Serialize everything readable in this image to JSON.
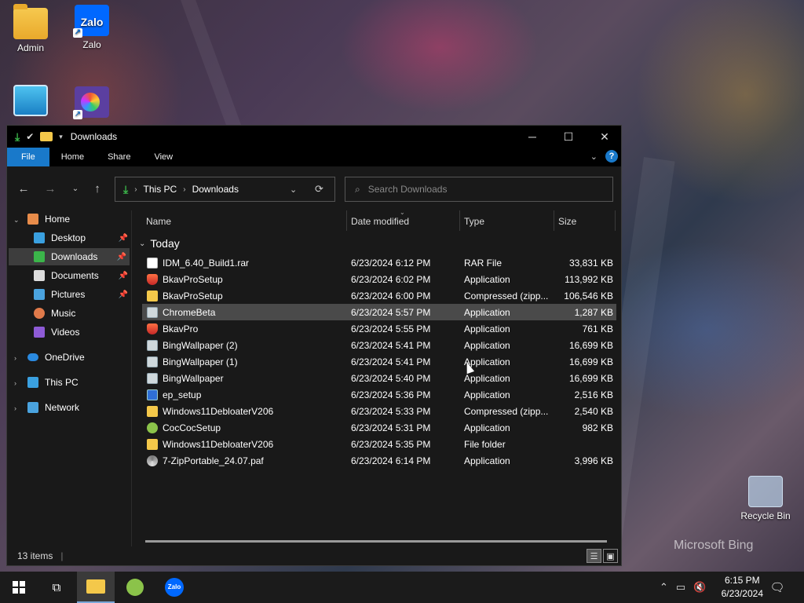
{
  "desktop": {
    "icons": [
      {
        "label": "Admin"
      },
      {
        "label": "Zalo"
      },
      {
        "label": ""
      },
      {
        "label": ""
      },
      {
        "label": "Recycle Bin"
      }
    ],
    "watermark": "Microsoft Bing"
  },
  "window": {
    "title": "Downloads",
    "controls": {
      "minimize": "─",
      "maximize": "☐",
      "close": "✕"
    },
    "ribbon_tabs": [
      "File",
      "Home",
      "Share",
      "View"
    ],
    "address": {
      "crumbs": [
        "This PC",
        "Downloads"
      ]
    },
    "search": {
      "placeholder": "Search Downloads"
    },
    "sidebar": {
      "items": [
        {
          "label": "Home"
        },
        {
          "label": "Desktop"
        },
        {
          "label": "Downloads"
        },
        {
          "label": "Documents"
        },
        {
          "label": "Pictures"
        },
        {
          "label": "Music"
        },
        {
          "label": "Videos"
        },
        {
          "label": "OneDrive"
        },
        {
          "label": "This PC"
        },
        {
          "label": "Network"
        }
      ]
    },
    "columns": {
      "name": "Name",
      "date": "Date modified",
      "type": "Type",
      "size": "Size"
    },
    "group": "Today",
    "files": [
      {
        "name": "IDM_6.40_Build1.rar",
        "date": "6/23/2024 6:12 PM",
        "type": "RAR File",
        "size": "33,831 KB",
        "icon": "rar-icon"
      },
      {
        "name": "BkavProSetup",
        "date": "6/23/2024 6:02 PM",
        "type": "Application",
        "size": "113,992 KB",
        "icon": "shield-icon"
      },
      {
        "name": "BkavProSetup",
        "date": "6/23/2024 6:00 PM",
        "type": "Compressed (zipp...",
        "size": "106,546 KB",
        "icon": "zip-folder-icon"
      },
      {
        "name": "ChromeBeta",
        "date": "6/23/2024 5:57 PM",
        "type": "Application",
        "size": "1,287 KB",
        "icon": "app-icon"
      },
      {
        "name": "BkavPro",
        "date": "6/23/2024 5:55 PM",
        "type": "Application",
        "size": "761 KB",
        "icon": "shield-icon"
      },
      {
        "name": "BingWallpaper (2)",
        "date": "6/23/2024 5:41 PM",
        "type": "Application",
        "size": "16,699 KB",
        "icon": "app-icon"
      },
      {
        "name": "BingWallpaper (1)",
        "date": "6/23/2024 5:41 PM",
        "type": "Application",
        "size": "16,699 KB",
        "icon": "app-icon"
      },
      {
        "name": "BingWallpaper",
        "date": "6/23/2024 5:40 PM",
        "type": "Application",
        "size": "16,699 KB",
        "icon": "app-icon"
      },
      {
        "name": "ep_setup",
        "date": "6/23/2024 5:36 PM",
        "type": "Application",
        "size": "2,516 KB",
        "icon": "setup-icon"
      },
      {
        "name": "Windows11DebloaterV206",
        "date": "6/23/2024 5:33 PM",
        "type": "Compressed (zipp...",
        "size": "2,540 KB",
        "icon": "zip-folder-icon"
      },
      {
        "name": "CocCocSetup",
        "date": "6/23/2024 5:31 PM",
        "type": "Application",
        "size": "982 KB",
        "icon": "coccoc-icon"
      },
      {
        "name": "Windows11DebloaterV206",
        "date": "6/23/2024 5:35 PM",
        "type": "File folder",
        "size": "",
        "icon": "folder-icon"
      },
      {
        "name": "7-ZipPortable_24.07.paf",
        "date": "6/23/2024 6:14 PM",
        "type": "Application",
        "size": "3,996 KB",
        "icon": "paf-icon"
      }
    ],
    "selected_index": 3,
    "status": "13 items"
  },
  "taskbar": {
    "zalo_label": "Zalo",
    "clock_time": "6:15 PM",
    "clock_date": "6/23/2024"
  }
}
